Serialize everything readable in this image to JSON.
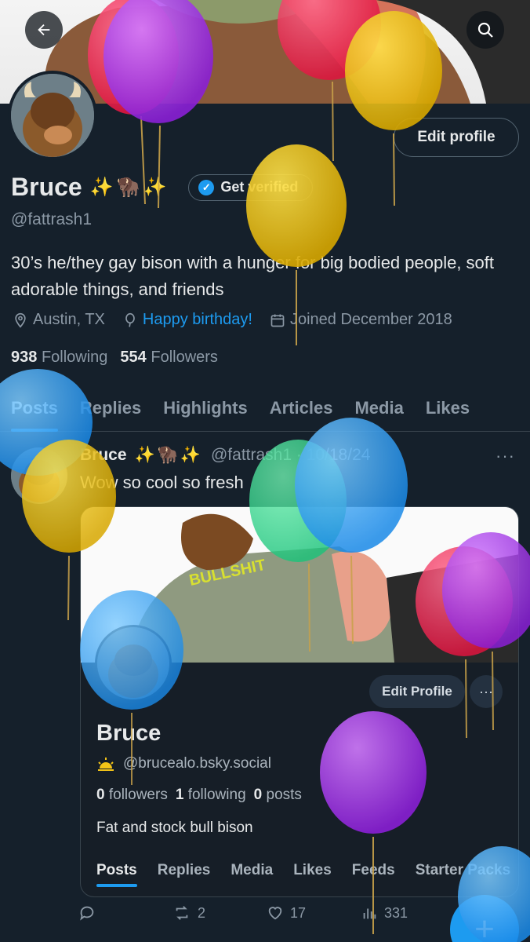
{
  "header": {
    "back_icon": "arrow-left-icon",
    "search_icon": "search-icon"
  },
  "profile": {
    "edit_label": "Edit profile",
    "name": "Bruce",
    "name_emoji": "✨🦬✨",
    "verify_label": "Get verified",
    "handle": "@fattrash1",
    "bio": "30’s he/they gay bison with a hunger for big bodied people, soft adorable things, and friends",
    "location": "Austin, TX",
    "birthday": "Happy birthday!",
    "joined": "Joined December 2018",
    "following_count": "938",
    "following_label": "Following",
    "followers_count": "554",
    "followers_label": "Followers"
  },
  "tabs": [
    "Posts",
    "Replies",
    "Highlights",
    "Articles",
    "Media",
    "Likes"
  ],
  "post": {
    "name": "Bruce",
    "emoji": "✨🦬✨",
    "handle": "@fattrash1 · 10/18/24",
    "more": "···",
    "text": "Wow so cool so fresh",
    "card": {
      "banner_text": "BULLSHIT",
      "edit_label": "Edit Profile",
      "more": "···",
      "name": "Bruce",
      "weather_icon": "sun-icon",
      "handle": "@brucealo.bsky.social",
      "followers_count": "0",
      "followers_label": "followers",
      "following_count": "1",
      "following_label": "following",
      "posts_count": "0",
      "posts_label": "posts",
      "bio": "Fat and stock bull bison",
      "tabs": [
        "Posts",
        "Replies",
        "Media",
        "Likes",
        "Feeds",
        "Starter Packs"
      ]
    },
    "actions": {
      "reply_count": "",
      "repost_count": "2",
      "like_count": "17",
      "views_count": "331"
    }
  },
  "fab_label": "+",
  "colors": {
    "background": "#15202b",
    "accent": "#1d9bf0",
    "muted": "#8b98a5"
  }
}
